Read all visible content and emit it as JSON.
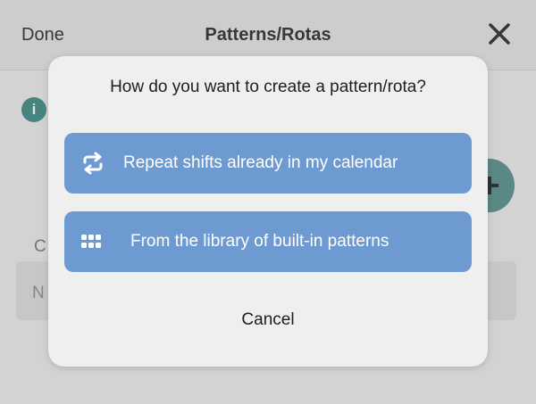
{
  "nav": {
    "done_label": "Done",
    "title": "Patterns/Rotas",
    "close_icon": "close-icon"
  },
  "background": {
    "info_glyph": "i",
    "partial_label_c": "C",
    "partial_field_n": "N"
  },
  "modal": {
    "title": "How do you want to create a pattern/rota?",
    "options": [
      {
        "label": "Repeat shifts already in my calendar",
        "icon": "repeat-icon"
      },
      {
        "label": "From the library of built-in patterns",
        "icon": "grid-dots-icon"
      }
    ],
    "cancel_label": "Cancel"
  },
  "colors": {
    "option_button": "#6e9ad2",
    "modal_background": "#efefef",
    "accent_teal": "#4a8a86"
  }
}
